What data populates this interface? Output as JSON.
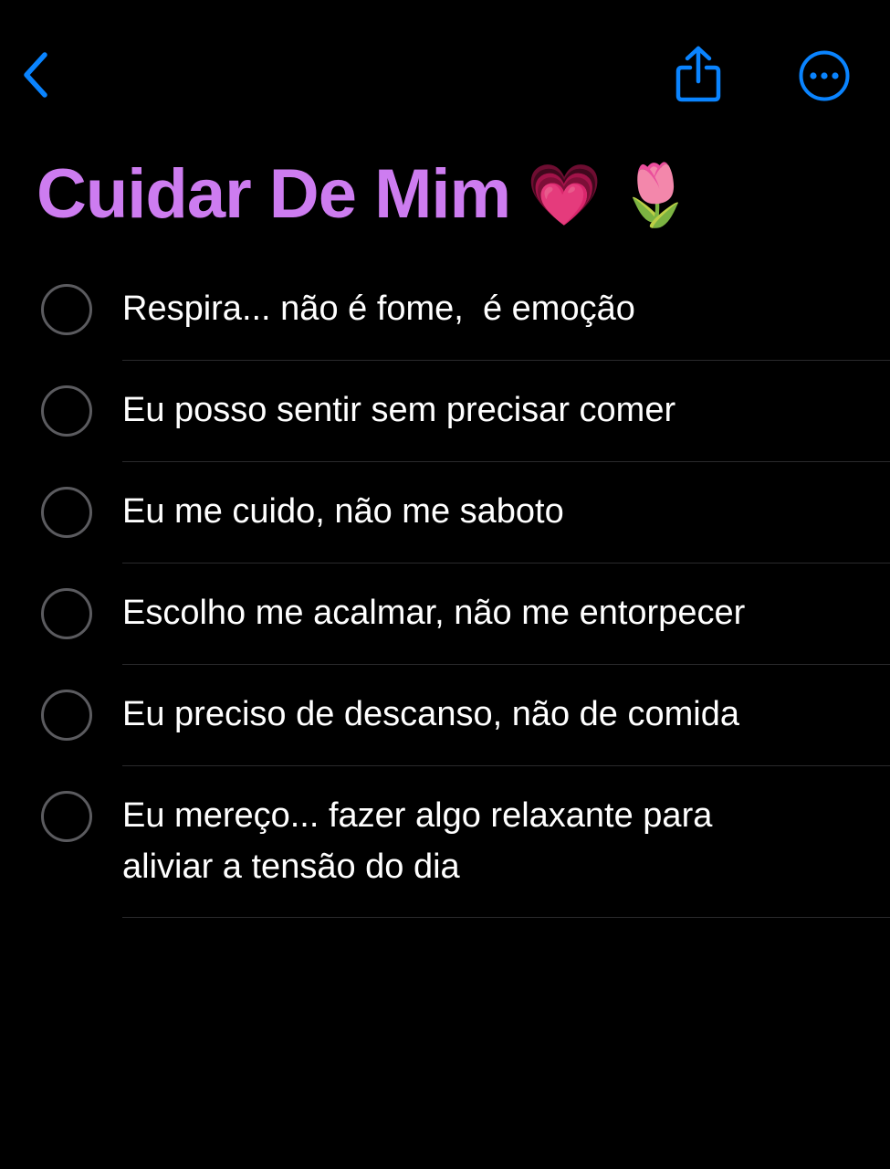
{
  "colors": {
    "accent": "#0a84ff",
    "title": "#cd7cf0",
    "background": "#000000",
    "checkbox_border": "#5b5b5f",
    "separator": "#2a2a2c"
  },
  "toolbar": {
    "back_icon": "chevron-left-icon",
    "share_icon": "share-icon",
    "more_icon": "ellipsis-circle-icon"
  },
  "note": {
    "title": "Cuidar De Mim",
    "title_emoji": [
      "💗",
      "🌷"
    ],
    "items": [
      {
        "text": "Respira... não é fome,  é emoção",
        "checked": false
      },
      {
        "text": "Eu posso sentir sem precisar comer",
        "checked": false
      },
      {
        "text": "Eu me cuido, não me saboto",
        "checked": false
      },
      {
        "text": "Escolho me acalmar, não me entorpecer",
        "checked": false
      },
      {
        "text": "Eu preciso de descanso, não de comida",
        "checked": false
      },
      {
        "text": "Eu mereço... fazer algo relaxante para aliviar a tensão do dia",
        "checked": false
      }
    ]
  }
}
